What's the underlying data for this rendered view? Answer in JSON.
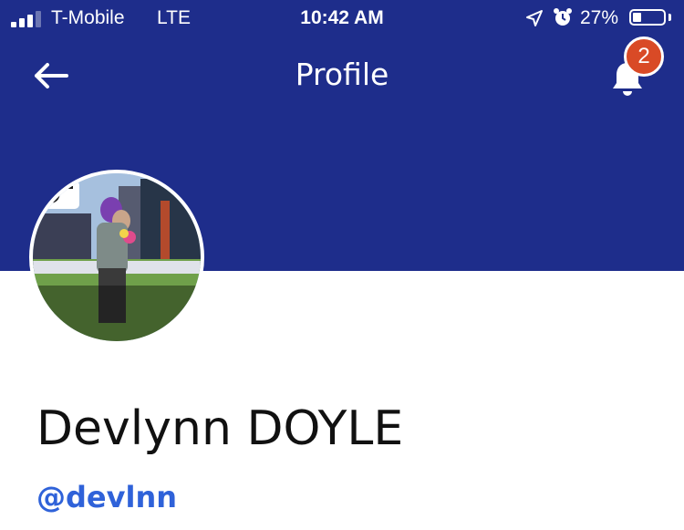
{
  "status_bar": {
    "carrier": "T-Mobile",
    "network": "LTE",
    "time": "10:42 AM",
    "battery_percent_label": "27%",
    "battery_level": 0.27,
    "signal_bars_filled": 3,
    "signal_bars_total": 4,
    "icons": [
      "signal-icon",
      "location-arrow-icon",
      "alarm-clock-icon",
      "battery-icon"
    ]
  },
  "nav": {
    "title": "Profile",
    "back_icon": "arrow-left-icon",
    "notifications_icon": "bell-icon",
    "notification_count": "2"
  },
  "profile": {
    "avatar_alt": "profile photo",
    "avatar_overlay_icon": "camera-icon",
    "display_name": "Devlynn DOYLE",
    "handle": "@devlnn"
  },
  "colors": {
    "header_background": "#1e2d8b",
    "badge": "#d94a26",
    "handle_link": "#2f62d9",
    "name_text": "#111111"
  }
}
